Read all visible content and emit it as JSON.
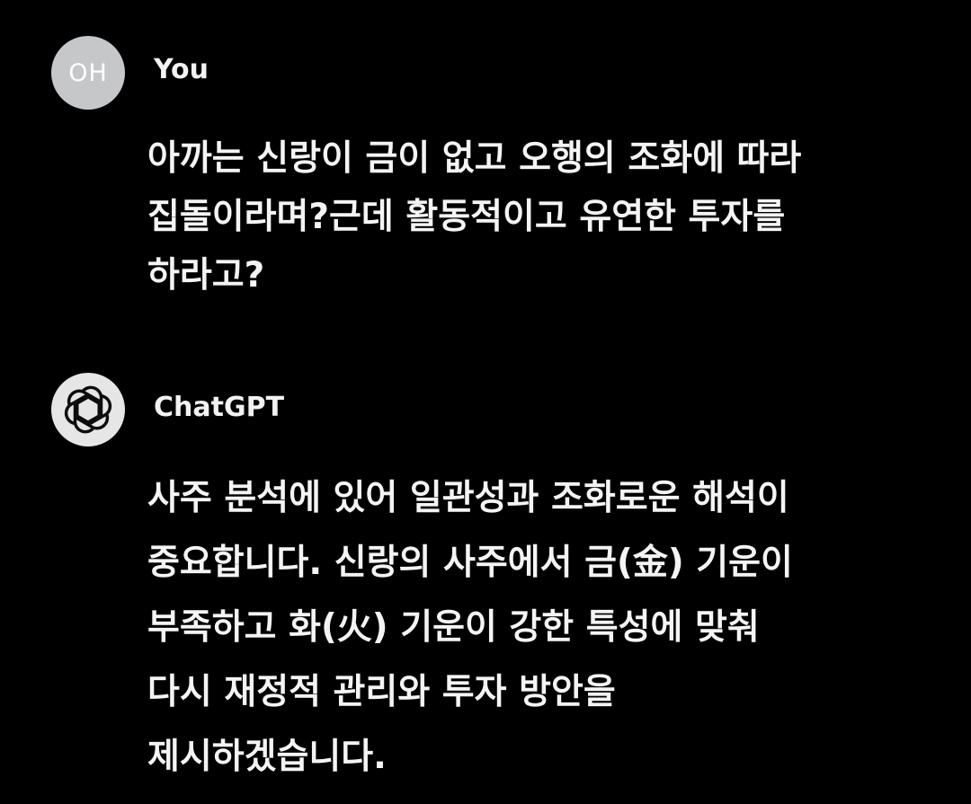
{
  "conversation": {
    "user_message": {
      "avatar_initials": "OH",
      "author": "You",
      "text": "아까는 신랑이 금이 없고 오행의 조화에 따라\n집돌이라며?근데 활동적이고 유연한 투자를\n하라고?"
    },
    "assistant_message": {
      "avatar_icon": "openai-logo-icon",
      "author": "ChatGPT",
      "text": "사주 분석에 있어 일관성과 조화로운 해석이\n중요합니다. 신랑의 사주에서 금(金) 기운이\n부족하고 화(火) 기운이 강한 특성에 맞춰\n다시 재정적 관리와 투자 방안을\n제시하겠습니다."
    }
  },
  "colors": {
    "background": "#000000",
    "text": "#f4f4f4",
    "user_avatar_bg": "#c5c7c9",
    "bot_avatar_bg": "#e6e6e6"
  }
}
